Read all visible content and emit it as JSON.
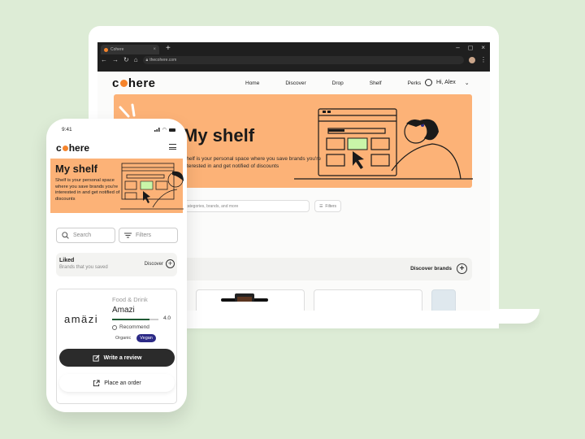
{
  "browser": {
    "tab_title": "Cohere",
    "tab_close": "×",
    "new_tab": "+",
    "url": "thecohere.com",
    "window_controls": [
      "–",
      "◻",
      "×"
    ],
    "nav_icons": [
      "←",
      "→",
      "↻",
      "⌂"
    ]
  },
  "desktop": {
    "logo": {
      "pre": "c",
      "post": "here"
    },
    "nav": [
      "Home",
      "Discover",
      "Drop",
      "Shelf",
      "Perks"
    ],
    "user_greeting": "Hi, Alex",
    "user_chevron": "⌄",
    "hero": {
      "title": "My shelf",
      "description": "Shelf is your personal space where you save brands you're interested in and get notified of discounts"
    },
    "search_placeholder": "Search categories, brands, and more",
    "filters_label": "Filters",
    "discover_brands_label": "Discover brands",
    "plus": "+"
  },
  "mobile": {
    "time": "9:41",
    "logo": {
      "pre": "c",
      "post": "here"
    },
    "hero": {
      "title": "My shelf",
      "description": "Shelf is your personal space where you save brands you're interested in and get notified of discounts"
    },
    "search_placeholder": "Search",
    "filters_label": "Filters",
    "liked": {
      "title": "Liked",
      "subtitle": "Brands that you saved",
      "discover_label": "Discover",
      "plus": "+"
    },
    "card": {
      "brand_logo": "amäzi",
      "category": "Food & Drink",
      "name": "Amazi",
      "rating": 4.0,
      "rating_text": "4.0",
      "rating_max": 5,
      "recommend_label": "Recommend",
      "tags": [
        "Organic",
        "Vegan"
      ],
      "write_review_label": "Write a review",
      "place_order_label": "Place an order"
    }
  },
  "colors": {
    "background": "#ddecd6",
    "accent_orange": "#f5842c",
    "hero_peach": "#fcb277",
    "vegan_tag": "#2c2a86",
    "rating_fill": "#1f5a34",
    "dark_button": "#2b2b2b"
  }
}
